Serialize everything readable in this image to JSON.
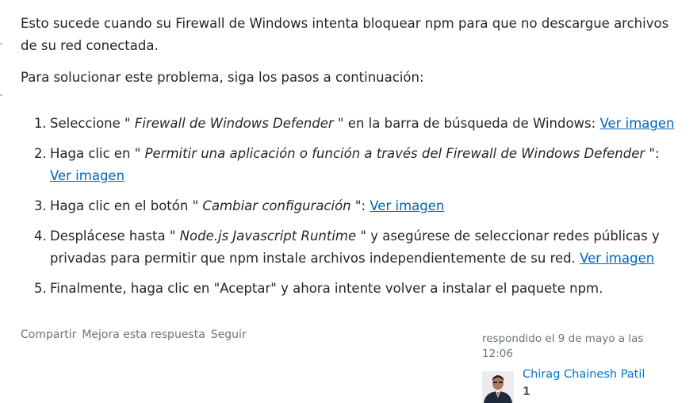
{
  "intro": {
    "para1": "Esto sucede cuando su Firewall de Windows intenta bloquear npm para que no descargue archivos de su red conectada.",
    "para2": "Para solucionar este problema, siga los pasos a continuación:"
  },
  "steps": [
    {
      "num": "1.",
      "before": "Seleccione \" ",
      "em": "Firewall de Windows Defender",
      "after": " \" en la barra de búsqueda de Windows: ",
      "link": "Ver imagen"
    },
    {
      "num": "2.",
      "before": "Haga clic en \" ",
      "em": "Permitir una aplicación o función a través del Firewall de Windows Defender",
      "after": " \": ",
      "link": "Ver imagen"
    },
    {
      "num": "3.",
      "before": "Haga clic en el botón \" ",
      "em": "Cambiar configuración",
      "after": " \": ",
      "link": "Ver imagen"
    },
    {
      "num": "4.",
      "before": "Desplácese hasta \" ",
      "em": "Node.js Javascript Runtime",
      "after": " \" y asegúrese de seleccionar redes públicas y privadas para permitir que npm instale archivos independientemente de su red. ",
      "link": "Ver imagen"
    },
    {
      "num": "5.",
      "text": "Finalmente, haga clic en \"Aceptar\" y ahora intente volver a instalar el paquete npm."
    }
  ],
  "post_menu": {
    "share": "Compartir",
    "improve": "Mejora esta respuesta",
    "follow": "Seguir"
  },
  "signature": {
    "action_time": "respondido el 9 de mayo a las 12:06",
    "user_name": "Chirag Chainesh Patil",
    "reputation": "1"
  },
  "colors": {
    "link": "#0063b8",
    "user_link": "#0074cc",
    "muted": "#6a737c",
    "text": "#232629"
  }
}
